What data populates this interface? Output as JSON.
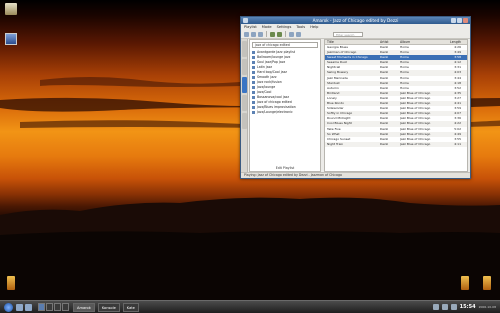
{
  "window": {
    "title": "Amarok - Jazz of Chicago edited by Dezzi",
    "menus": [
      "Playlist",
      "Mode",
      "Settings",
      "Tools",
      "Help"
    ],
    "search_placeholder": "Filter search"
  },
  "left_pane": {
    "search_value": "jazz of chicago edited",
    "items": [
      "Avantgarde Jazz playlist",
      "Ballroom/lounge jazz",
      "Soul jazz/Pop Jazz",
      "Latin jazz",
      "Hard bop/Cool jazz",
      "Smooth jazz",
      "Jazz rock/fusion",
      "Jazz/lounge",
      "Jazz/Cool",
      "Bossanova/cool jazz",
      "Jazz of chicago edited",
      "Jazz/Blues improvisation",
      "Jazz/Lounge/electronic"
    ],
    "footer": "Edit Playlist"
  },
  "table": {
    "headers": [
      "Title",
      "Artist",
      "Album",
      "Length"
    ],
    "rows": [
      {
        "title": "Georgia Blues",
        "artist": "Dezzi",
        "album": "Home",
        "length": "4:26"
      },
      {
        "title": "Jazzman of Chicago",
        "artist": "Dezzi",
        "album": "Home",
        "length": "3:49"
      },
      {
        "title": "Sweet Moments in Chicago",
        "artist": "Dezzi",
        "album": "Home",
        "length": "3:58"
      },
      {
        "title": "Sesame Dust",
        "artist": "Dezzi",
        "album": "Home",
        "length": "4:12"
      },
      {
        "title": "Nightcall",
        "artist": "Dezzi",
        "album": "Home",
        "length": "3:31"
      },
      {
        "title": "Swing Bowery",
        "artist": "Dezzi",
        "album": "Home",
        "length": "4:03"
      },
      {
        "title": "Jazz Marinade",
        "artist": "Dezzi",
        "album": "Home",
        "length": "3:44"
      },
      {
        "title": "Stardust",
        "artist": "Dezzi",
        "album": "Home",
        "length": "4:18"
      },
      {
        "title": "Autumn",
        "artist": "Dezzi",
        "album": "Home",
        "length": "3:52"
      },
      {
        "title": "Birdland",
        "artist": "Dezzi",
        "album": "Jazz Blue of Chicago",
        "length": "4:35"
      },
      {
        "title": "Lonely",
        "artist": "Dezzi",
        "album": "Jazz Blue of Chicago",
        "length": "3:27"
      },
      {
        "title": "Blue Rondo",
        "artist": "Dezzi",
        "album": "Jazz Blue of Chicago",
        "length": "4:41"
      },
      {
        "title": "Sidewinder",
        "artist": "Dezzi",
        "album": "Jazz Blue of Chicago",
        "length": "3:59"
      },
      {
        "title": "Softly in Chicago",
        "artist": "Dezzi",
        "album": "Jazz Blue of Chicago",
        "length": "4:07"
      },
      {
        "title": "Round Midnight",
        "artist": "Dezzi",
        "album": "Jazz Blue of Chicago",
        "length": "3:36"
      },
      {
        "title": "Cool Blues Night",
        "artist": "Dezzi",
        "album": "Jazz Blue of Chicago",
        "length": "4:22"
      },
      {
        "title": "Take Five",
        "artist": "Dezzi",
        "album": "Jazz Blue of Chicago",
        "length": "5:02"
      },
      {
        "title": "So What",
        "artist": "Dezzi",
        "album": "Jazz Blue of Chicago",
        "length": "4:49"
      },
      {
        "title": "Chicago Sunset",
        "artist": "Dezzi",
        "album": "Jazz Blue of Chicago",
        "length": "3:55"
      },
      {
        "title": "Night Train",
        "artist": "Dezzi",
        "album": "Jazz Blue of Chicago",
        "length": "4:11"
      }
    ],
    "selected_index": 2
  },
  "statusbar": "Playing: Jazz of Chicago edited by Dezzi - Jazzman of Chicago",
  "taskbar": {
    "tasks": [
      "Amarok",
      "Konsole",
      "Kate"
    ],
    "active_task": 0,
    "clock": "15:54",
    "date": "2006-10-08"
  },
  "desktop_icons": [
    "home-folder-icon",
    "trash-icon",
    "system-icon",
    "media-icon"
  ]
}
